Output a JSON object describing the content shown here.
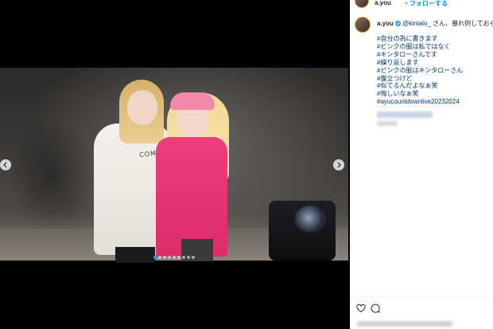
{
  "header": {
    "username": "a.you",
    "follow_label": "・フォローする"
  },
  "post": {
    "username": "a.you",
    "mention": "@kintalo_",
    "text_after_mention": " さん、暴れ倒しておられま",
    "hashtags": [
      "#自分の為に書きます",
      "#ピンクの服は私ではなく",
      "#キンタローさんです",
      "#繰り返します",
      "#ピンクの服はキンタローさん",
      "#腹立つけど",
      "#似てるんだよなぁ笑",
      "#悔しいなぁ笑",
      "#ayucountdownlive20232024"
    ]
  },
  "media": {
    "hoodie_text": "COMPLETE",
    "carousel_count": 9,
    "carousel_active_index": 0
  },
  "icons": {
    "prev": "chevron-left-icon",
    "next": "chevron-right-icon",
    "like": "heart-icon",
    "comment": "comment-icon",
    "verified": "verified-badge-icon"
  },
  "colors": {
    "accent": "#0095f6",
    "link": "#00376b",
    "verified": "#3897f0"
  }
}
